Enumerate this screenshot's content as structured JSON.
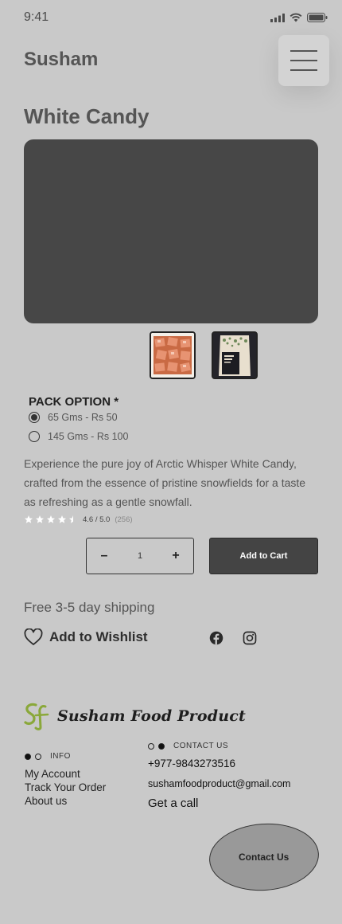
{
  "status_bar": {
    "time": "9:41"
  },
  "header": {
    "brand": "Susham"
  },
  "product": {
    "title": "White Candy",
    "pack_option_label": "PACK OPTION *",
    "options": [
      {
        "label": "65 Gms - Rs 50",
        "selected": true
      },
      {
        "label": "145 Gms - Rs 100",
        "selected": false
      }
    ],
    "description": "Experience the pure joy of Arctic Whisper White Candy, crafted from the essence of pristine snowfields for a taste as refreshing as a gentle snowfall.",
    "rating": {
      "value": "4.6 / 5.0",
      "count": "(256)",
      "stars": 4.5
    },
    "quantity": {
      "minus": "–",
      "value": "1",
      "plus": "+"
    },
    "add_to_cart": "Add to Cart",
    "shipping": "Free 3-5 day shipping",
    "wishlist": "Add to Wishlist"
  },
  "footer": {
    "logo_text": "Susham Food Product",
    "info_heading": "INFO",
    "info_links": [
      "My Account",
      "Track Your Order",
      "About us"
    ],
    "contact_heading": "CONTACT US",
    "phone": "+977-9843273516",
    "email": "sushamfoodproduct@gmail.com",
    "call": "Get a call",
    "contact_button": "Contact Us"
  },
  "colors": {
    "background": "#c9c9c9",
    "hero": "#474747",
    "cart_button": "#444444",
    "logo_green": "#8aa83a"
  }
}
